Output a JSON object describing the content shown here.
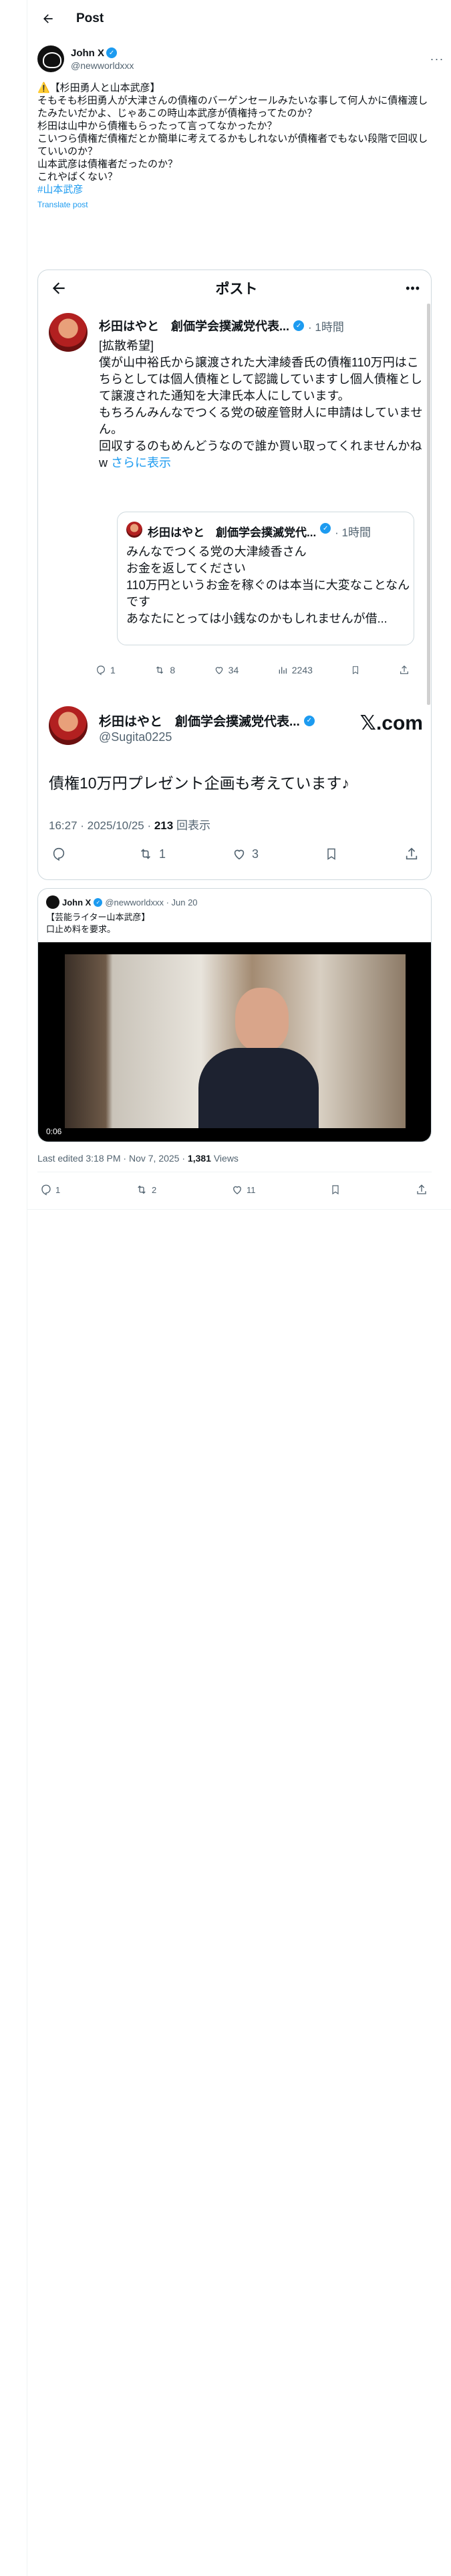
{
  "header": {
    "title": "Post"
  },
  "author": {
    "name": "John X",
    "handle": "@newworldxxx",
    "more": "···"
  },
  "post": {
    "lines": [
      "⚠️【杉田勇人と山本武彦】",
      "そもそも杉田勇人が大津さんの債権のバーゲンセールみたいな事して何人かに債権渡したみたいだかよ、じゃあこの時山本武彦が債権持ってたのか？",
      "杉田は山中から債権もらったって言ってなかったか？",
      "こいつら債権だ債権だとか簡単に考えてるかもしれないが債権者でもない段階で回収していいのか？",
      "山本武彦は債権者だったのか？",
      "これやばくない？"
    ],
    "hashtag": "#山本武彦",
    "translate": "Translate post"
  },
  "embed": {
    "screen_title": "ポスト",
    "more": "•••",
    "tweet": {
      "name": "杉田はやと　創価学会撲滅党代表...",
      "time": "· 1時間",
      "text": [
        "[拡散希望]",
        "僕が山中裕氏から譲渡された大津綾香氏の債権110万円はこちらとしては個人債権として認識していますし個人債権として譲渡された通知を大津氏本人にしています。",
        "もちろんみんなでつくる党の破産管財人に申請はしていません。",
        "回収するのもめんどうなので誰か買い取ってくれませんかねw"
      ],
      "read_more": "さらに表示"
    },
    "quote": {
      "name": "杉田はやと　創価学会撲滅党代...",
      "time": "· 1時間",
      "text": [
        "みんなでつくる党の大津綾香さん",
        "お金を返してください",
        "110万円というお金を稼ぐのは本当に大変なことなんです",
        "あなたにとっては小銭なのかもしれませんが借..."
      ]
    },
    "stats": {
      "replies": "1",
      "reposts": "8",
      "likes": "34",
      "views": "2243"
    },
    "tweet2": {
      "name": "杉田はやと　創価学会撲滅党代表...",
      "handle": "@Sugita0225",
      "x_logo": "𝕏.com",
      "text": "債権10万円プレゼント企画も考えています♪",
      "meta_date": "16:27 · 2025/10/25 · ",
      "meta_views": "213",
      "meta_views_label": " 回表示",
      "replies": "",
      "reposts": "1",
      "likes": "3"
    }
  },
  "embed2": {
    "name": "John X",
    "handle": "@newworldxxx · Jun 20",
    "text": [
      "【芸能ライター山本武彦】",
      "口止め料を要求。"
    ],
    "video_time": "0:06"
  },
  "footer": {
    "edited": "Last edited 3:18 PM · Nov 7, 2025 · ",
    "views": "1,381",
    "views_label": " Views",
    "replies": "1",
    "reposts": "2",
    "likes": "11"
  },
  "colors": {
    "accent": "#1d9bf0",
    "muted": "#536471",
    "border": "#cfd9de"
  }
}
